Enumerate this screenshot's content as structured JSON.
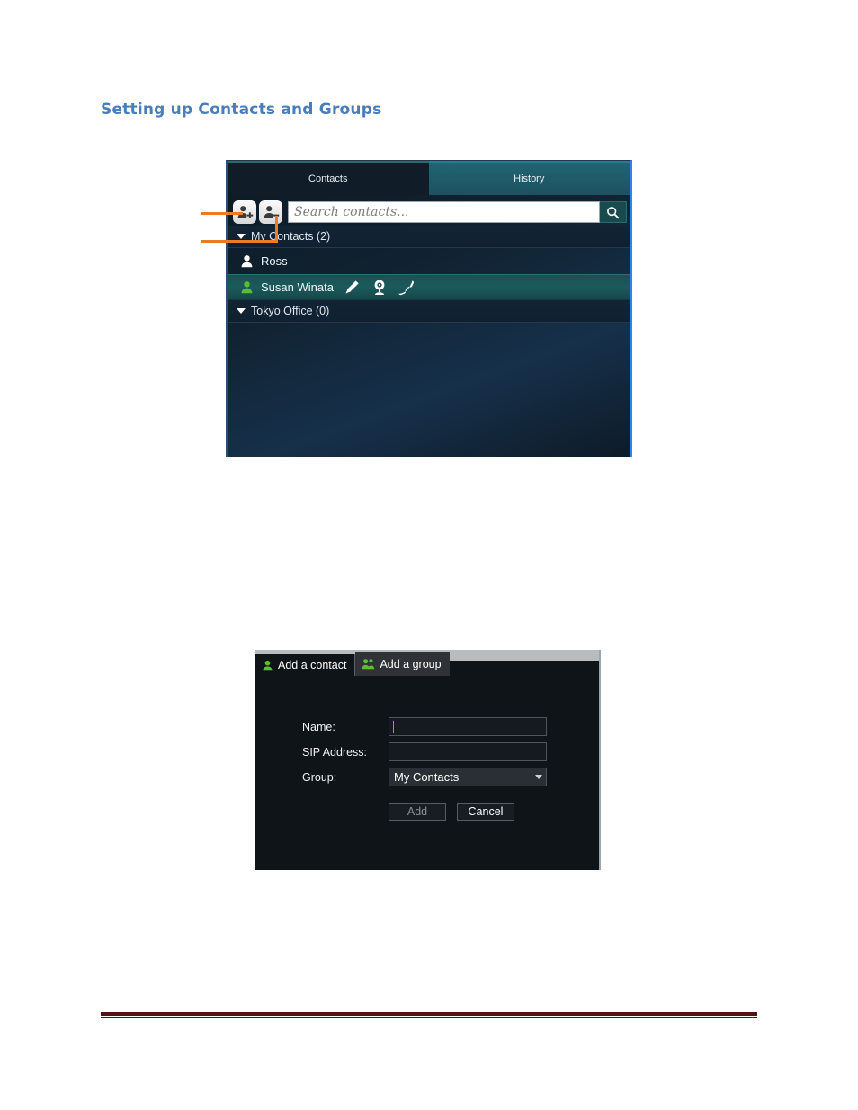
{
  "document": {
    "heading": "Setting up Contacts and Groups"
  },
  "contacts_panel": {
    "tabs": [
      {
        "label": "Contacts",
        "active": true
      },
      {
        "label": "History",
        "active": false
      }
    ],
    "toolbar": {
      "add_contact_icon": "add-person-icon",
      "remove_contact_icon": "remove-person-icon",
      "search_icon": "search-icon"
    },
    "search": {
      "value": "",
      "placeholder": "Search contacts..."
    },
    "groups": [
      {
        "label": "My Contacts (2)",
        "contacts": [
          {
            "name": "Ross",
            "status": "offline",
            "selected": false
          },
          {
            "name": "Susan Winata",
            "status": "online",
            "selected": true,
            "actions": [
              "pencil-icon",
              "webcam-icon",
              "phone-icon"
            ]
          }
        ]
      },
      {
        "label": "Tokyo Office (0)",
        "contacts": []
      }
    ]
  },
  "add_dialog": {
    "tabs": [
      {
        "label": "Add a contact",
        "icon": "person-icon",
        "active": true
      },
      {
        "label": "Add a group",
        "icon": "group-icon",
        "active": false
      }
    ],
    "fields": {
      "name_label": "Name:",
      "name_value": "",
      "sip_label": "SIP Address:",
      "sip_value": "",
      "group_label": "Group:",
      "group_value": "My Contacts"
    },
    "buttons": {
      "add": "Add",
      "cancel": "Cancel"
    }
  },
  "colors": {
    "heading": "#4a7ebb",
    "callout": "#ec7b22",
    "footer_rule": "#4f1516",
    "online_green": "#5bbf2d",
    "panel_accent": "#2f86e0"
  }
}
